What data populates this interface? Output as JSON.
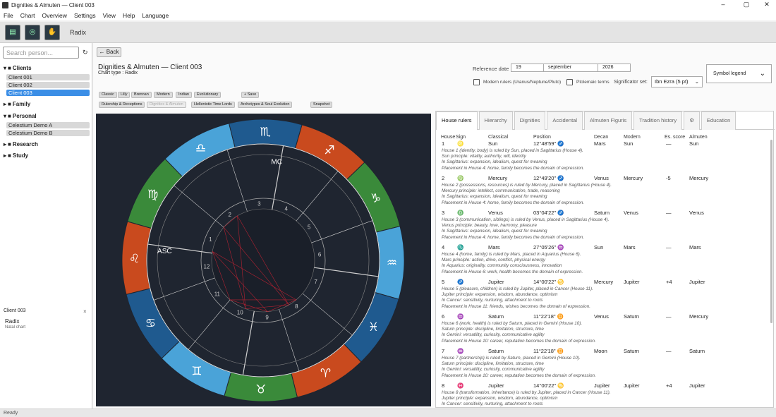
{
  "window": {
    "title": "Dignities & Almuten — Client 003"
  },
  "menu": [
    "File",
    "Chart",
    "Overview",
    "Settings",
    "View",
    "Help",
    "Language"
  ],
  "toolbar": {
    "label": "Radix"
  },
  "sidebar": {
    "search_placeholder": "Search person...",
    "groups": [
      {
        "label": "Clients",
        "items": [
          "Client 001",
          "Client 002",
          "Client 003"
        ]
      },
      {
        "label": "Family",
        "items": []
      },
      {
        "label": "Personal",
        "items": [
          "Celestium Demo A",
          "Celestium Demo B"
        ]
      },
      {
        "label": "Research",
        "items": []
      },
      {
        "label": "Study",
        "items": []
      }
    ],
    "panel": {
      "name": "Client 003",
      "type": "Radix",
      "sub": "Natal chart"
    }
  },
  "main": {
    "back": "← Back",
    "title": "Dignities & Almuten — Client 003",
    "chart_type": "Chart type :  Radix",
    "row1_buttons": [
      "Classic",
      "Lilly",
      "Brennan",
      "Modern",
      "Indian",
      "Evolutionary"
    ],
    "save": "+ Save",
    "row2_buttons": [
      "Rulership & Receptions",
      "Dignities & Almuten",
      "Hellenistic Time Lords",
      "Archetypes & Soul Evolution"
    ],
    "snapshot": "Snapshot",
    "reference_label": "Reference date",
    "date": {
      "day": "19",
      "month": "september",
      "year": "2026"
    },
    "modern_rulers": "Modern rulers (Uranus/Neptune/Pluto)",
    "ptolemaic": "Ptolemaic terms",
    "significator_label": "Significator set:",
    "significator_value": "Ibn Ezra (5 pt)",
    "symbol_legend": "Symbol legend"
  },
  "tabs": [
    "House rulers",
    "Hierarchy",
    "Dignities",
    "Accidental",
    "Almuten Figuris",
    "Tradition history",
    "⚙",
    "Education"
  ],
  "table": {
    "headers": [
      "House",
      "Sign",
      "Classical",
      "Position",
      "Decan",
      "Modern",
      "Es. score",
      "Almuten"
    ],
    "rows": [
      {
        "house": "1",
        "sign": "♌",
        "classical": "Sun",
        "position": "12°48'59\" ♐",
        "decan": "Mars",
        "modern": "Sun",
        "score": "—",
        "almuten": "Sun",
        "lines": [
          "House 1 (identity, body) is ruled by Sun, placed in Sagittarius (House 4).",
          "Sun principle: vitality, authority, will, identity",
          "In Sagittarius: expansion, idealism, quest for meaning",
          "Placement in House 4: home, family becomes the domain of expression."
        ]
      },
      {
        "house": "2",
        "sign": "♍",
        "classical": "Mercury",
        "position": "12°49'20\" ♐",
        "decan": "Venus",
        "modern": "Mercury",
        "score": "-5",
        "almuten": "Mercury",
        "lines": [
          "House 2 (possessions, resources) is ruled by Mercury, placed in Sagittarius (House 4).",
          "Mercury principle: intellect, communication, trade, reasoning",
          "In Sagittarius: expansion, idealism, quest for meaning",
          "Placement in House 4: home, family becomes the domain of expression."
        ]
      },
      {
        "house": "3",
        "sign": "♎",
        "classical": "Venus",
        "position": "03°04'22\" ♐",
        "decan": "Saturn",
        "modern": "Venus",
        "score": "—",
        "almuten": "Venus",
        "lines": [
          "House 3 (communication, siblings) is ruled by Venus, placed in Sagittarius (House 4).",
          "Venus principle: beauty, love, harmony, pleasure",
          "In Sagittarius: expansion, idealism, quest for meaning",
          "Placement in House 4: home, family becomes the domain of expression."
        ]
      },
      {
        "house": "4",
        "sign": "♏",
        "classical": "Mars",
        "position": "27°05'26\" ♒",
        "decan": "Sun",
        "modern": "Mars",
        "score": "—",
        "almuten": "Mars",
        "lines": [
          "House 4 (home, family) is ruled by Mars, placed in Aquarius (House 6).",
          "Mars principle: action, drive, conflict, physical energy",
          "In Aquarius: originality, community consciousness, innovation",
          "Placement in House 6: work, health becomes the domain of expression."
        ]
      },
      {
        "house": "5",
        "sign": "♐",
        "classical": "Jupiter",
        "position": "14°00'22\" ♋",
        "decan": "Mercury",
        "modern": "Jupiter",
        "score": "+4",
        "almuten": "Jupiter",
        "lines": [
          "House 5 (pleasure, children) is ruled by Jupiter, placed in Cancer (House 11).",
          "Jupiter principle: expansion, wisdom, abundance, optimism",
          "In Cancer: sensitivity, nurturing, attachment to roots",
          "Placement in House 11: friends, wishes becomes the domain of expression."
        ]
      },
      {
        "house": "6",
        "sign": "♒",
        "classical": "Saturn",
        "position": "11°22'18\" ♊",
        "decan": "Venus",
        "modern": "Saturn",
        "score": "—",
        "almuten": "Mercury",
        "lines": [
          "House 6 (work, health) is ruled by Saturn, placed in Gemini (House 10).",
          "Saturn principle: discipline, limitation, structure, time",
          "In Gemini: versatility, curiosity, communicative agility",
          "Placement in House 10: career, reputation becomes the domain of expression."
        ]
      },
      {
        "house": "7",
        "sign": "♒",
        "classical": "Saturn",
        "position": "11°22'18\" ♊",
        "decan": "Moon",
        "modern": "Saturn",
        "score": "—",
        "almuten": "Saturn",
        "lines": [
          "House 7 (partnership) is ruled by Saturn, placed in Gemini (House 10).",
          "Saturn principle: discipline, limitation, structure, time",
          "In Gemini: versatility, curiosity, communicative agility",
          "Placement in House 10: career, reputation becomes the domain of expression."
        ]
      },
      {
        "house": "8",
        "sign": "♓",
        "classical": "Jupiter",
        "position": "14°00'22\" ♋",
        "decan": "Jupiter",
        "modern": "Jupiter",
        "score": "+4",
        "almuten": "Jupiter",
        "lines": [
          "House 8 (transformation, inheritance) is ruled by Jupiter, placed in Cancer (House 11).",
          "Jupiter principle: expansion, wisdom, abundance, optimism",
          "In Cancer: sensitivity, nurturing, attachment to roots"
        ]
      }
    ]
  },
  "chart": {
    "signs": [
      "♈",
      "♉",
      "♊",
      "♋",
      "♌",
      "♍",
      "♎",
      "♏",
      "♐",
      "♑",
      "♒",
      "♓"
    ],
    "sign_colors": [
      "#c94a1e",
      "#3a8a3a",
      "#4aa3d8",
      "#1f5a8f",
      "#c94a1e",
      "#3a8a3a",
      "#4aa3d8",
      "#1f5a8f",
      "#c94a1e",
      "#3a8a3a",
      "#4aa3d8",
      "#1f5a8f"
    ],
    "houses": [
      "1",
      "2",
      "3",
      "4",
      "5",
      "6",
      "7",
      "8",
      "9",
      "10",
      "11",
      "12"
    ],
    "asc": "ASC",
    "mc": "MC"
  },
  "status": "Ready"
}
